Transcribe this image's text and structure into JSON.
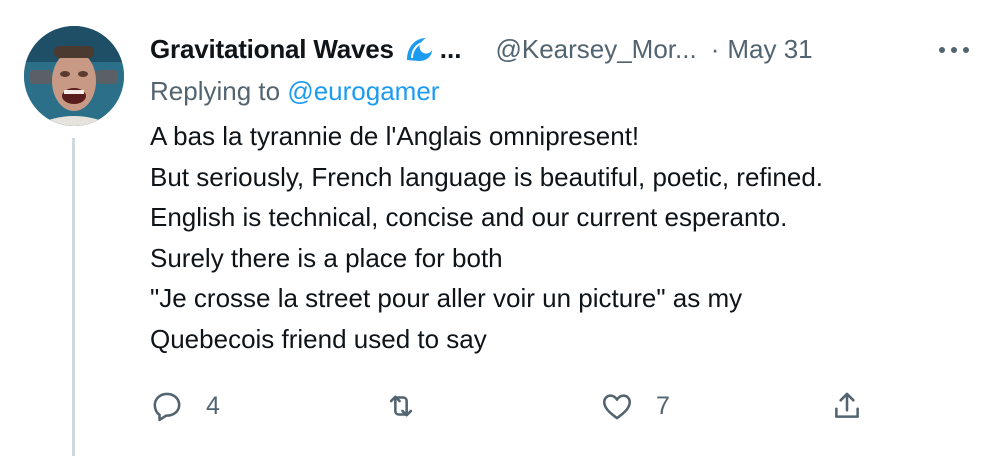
{
  "tweet": {
    "author": {
      "display_name": "Gravitational Waves",
      "name_emoji": "wave-emoji",
      "truncation": "...",
      "handle": "@Kearsey_Mor...",
      "date_separator": "·",
      "date": "May 31"
    },
    "replying_prefix": "Replying to",
    "replying_to": "@eurogamer",
    "lines": [
      "A bas la tyrannie de l'Anglais omnipresent!",
      "But seriously, French language is beautiful, poetic, refined.",
      "English is technical, concise and our current esperanto.",
      "Surely there is a place for both",
      "\"Je crosse la street pour aller voir un picture\" as my",
      "Quebecois friend used to say"
    ],
    "actions": {
      "reply_icon": "reply-icon",
      "reply_count": "4",
      "retweet_icon": "retweet-icon",
      "like_icon": "heart-icon",
      "like_count": "7",
      "share_icon": "share-icon"
    }
  },
  "colors": {
    "text": "#0f1419",
    "secondary": "#536471",
    "link": "#1d9bf0",
    "thread_line": "#cfd9de"
  }
}
